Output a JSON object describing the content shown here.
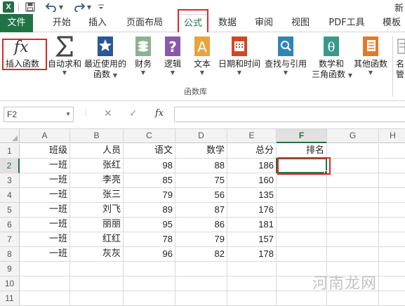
{
  "title_fragment": "新",
  "ribbon_tabs": [
    "文件",
    "开始",
    "插入",
    "页面布局",
    "公式",
    "数据",
    "审阅",
    "视图",
    "PDF工具",
    "模板"
  ],
  "active_tab": "公式",
  "ribbon_buttons": {
    "insert_function": "插入函数",
    "autosum": "自动求和",
    "recent_line1": "最近使用的",
    "recent_line2": "函数",
    "financial": "财务",
    "logical": "逻辑",
    "text": "文本",
    "datetime": "日期和时间",
    "lookup": "查找与引用",
    "math_line1": "数学和",
    "math_line2": "三角函数",
    "more": "其他函数",
    "name_manager_line1": "名",
    "name_manager_line2": "管"
  },
  "ribbon_group_label": "函数库",
  "fx_glyph": "fx",
  "formula_bar": {
    "name_box": "F2",
    "cancel_glyph": "✕",
    "enter_glyph": "✓",
    "fx_label": "fx",
    "formula": ""
  },
  "sheet": {
    "columns": [
      "A",
      "B",
      "C",
      "D",
      "E",
      "F",
      "G",
      "H"
    ],
    "selected_column": "F",
    "rows": [
      "1",
      "2",
      "3",
      "4",
      "5",
      "6",
      "7",
      "8",
      "9",
      "10",
      "11"
    ],
    "selected_row": "2",
    "headers": [
      "班级",
      "人员",
      "语文",
      "数学",
      "总分",
      "排名"
    ],
    "data": [
      [
        "一班",
        "张红",
        "98",
        "88",
        "186",
        ""
      ],
      [
        "一班",
        "李亮",
        "85",
        "75",
        "160",
        ""
      ],
      [
        "一班",
        "张三",
        "79",
        "56",
        "135",
        ""
      ],
      [
        "一班",
        "刘飞",
        "89",
        "87",
        "176",
        ""
      ],
      [
        "一班",
        "丽丽",
        "95",
        "86",
        "181",
        ""
      ],
      [
        "一班",
        "红红",
        "78",
        "79",
        "157",
        ""
      ],
      [
        "一班",
        "灰灰",
        "96",
        "82",
        "178",
        ""
      ]
    ],
    "active_cell": "F2"
  },
  "watermark": "河南龙网",
  "colors": {
    "excel_green": "#217346",
    "annotation_red": "#e0262b"
  }
}
